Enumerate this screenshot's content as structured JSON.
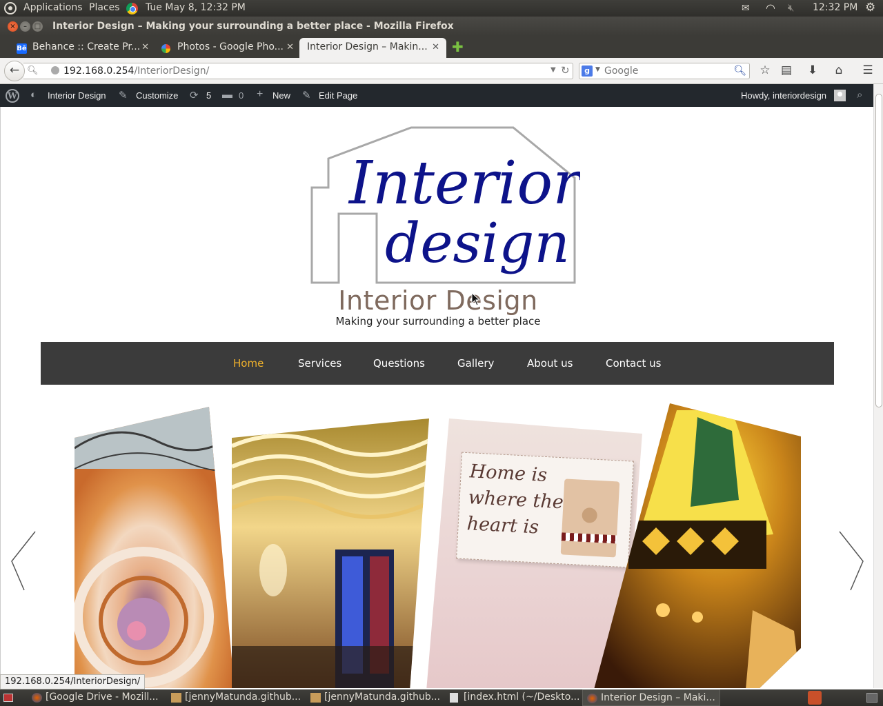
{
  "system_panel": {
    "applications": "Applications",
    "places": "Places",
    "datetime": "Tue May  8, 12:32 PM",
    "clock": "12:32 PM"
  },
  "window": {
    "title": "Interior Design – Making your surrounding a better place - Mozilla Firefox"
  },
  "tabs": [
    {
      "label": "Behance :: Create Pr...",
      "icon": "behance-icon",
      "active": false
    },
    {
      "label": "Photos - Google Pho...",
      "icon": "google-photos-icon",
      "active": false
    },
    {
      "label": "Interior Design – Makin...",
      "icon": "none",
      "active": true
    }
  ],
  "toolbar": {
    "url_host": "192.168.0.254",
    "url_path": "/InteriorDesign/",
    "search_placeholder": "Google"
  },
  "wp_admin": {
    "site_name": "Interior Design",
    "customize": "Customize",
    "updates_count": "5",
    "comments_count": "0",
    "new": "New",
    "edit_page": "Edit Page",
    "howdy": "Howdy, interiordesign"
  },
  "site": {
    "logo_line1": "Interior",
    "logo_line2": "design",
    "title": "Interior Design",
    "tagline": "Making your surrounding a better place",
    "nav": [
      "Home",
      "Services",
      "Questions",
      "Gallery",
      "About us",
      "Contact us"
    ],
    "sign_text": [
      "Home is",
      "where the",
      "heart is"
    ],
    "accent_color": "#f0b22c",
    "logo_color": "#0d138a"
  },
  "status_bar": "192.168.0.254/InteriorDesign/",
  "taskbar": [
    {
      "label": "[Google Drive - Mozill...",
      "icon": "firefox-icon"
    },
    {
      "label": "[jennyMatunda.github...",
      "icon": "folder-icon"
    },
    {
      "label": "[jennyMatunda.github...",
      "icon": "folder-icon"
    },
    {
      "label": "[index.html (~/Deskto...",
      "icon": "text-editor-icon"
    },
    {
      "label": "Interior Design – Maki...",
      "icon": "firefox-icon"
    }
  ]
}
